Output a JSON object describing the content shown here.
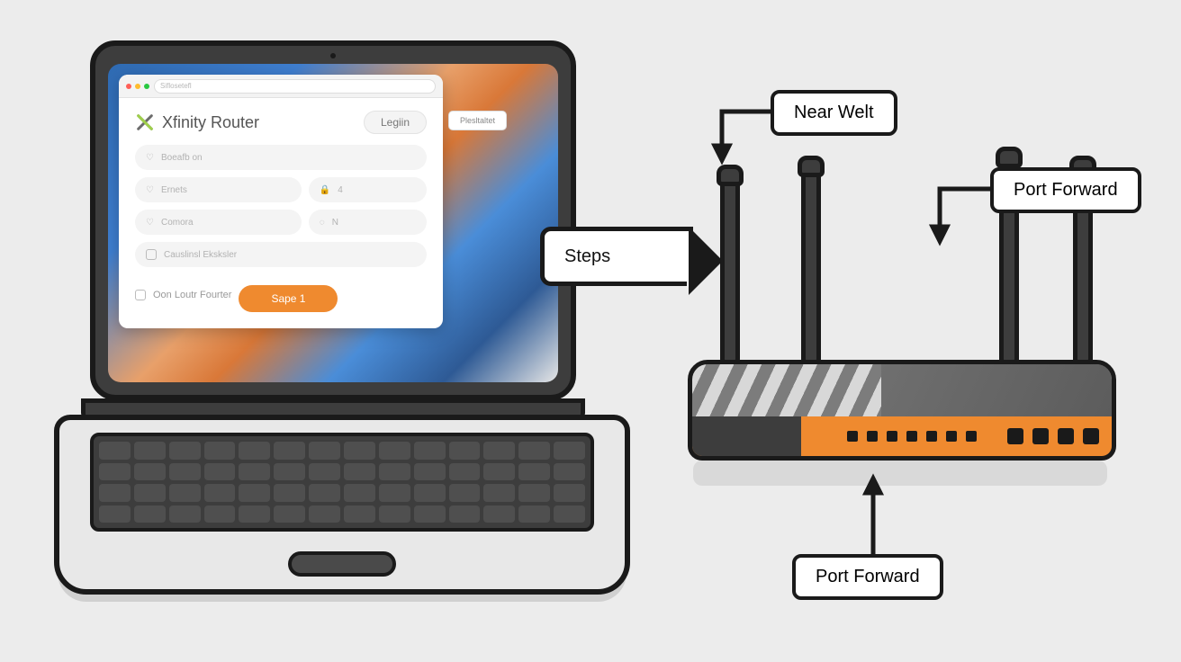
{
  "browser": {
    "url_placeholder": "Siflosetefl",
    "login_title": "Xfinity Router",
    "login_button": "Legiin",
    "external_link": "Plesltaltet",
    "fields": {
      "f1": "Boeafb on",
      "f2": "Ernets",
      "f2b": "4",
      "f3": "Comora",
      "f3b": "N",
      "f4": "Causlinsl Eksksler"
    },
    "remember": "Oon Loutr Fourter",
    "primary": "Sape 1"
  },
  "steps_label": "Steps",
  "labels": {
    "near_welt": "Near Welt",
    "port_forward_top": "Port Forward",
    "port_forward_bottom": "Port Forward"
  }
}
